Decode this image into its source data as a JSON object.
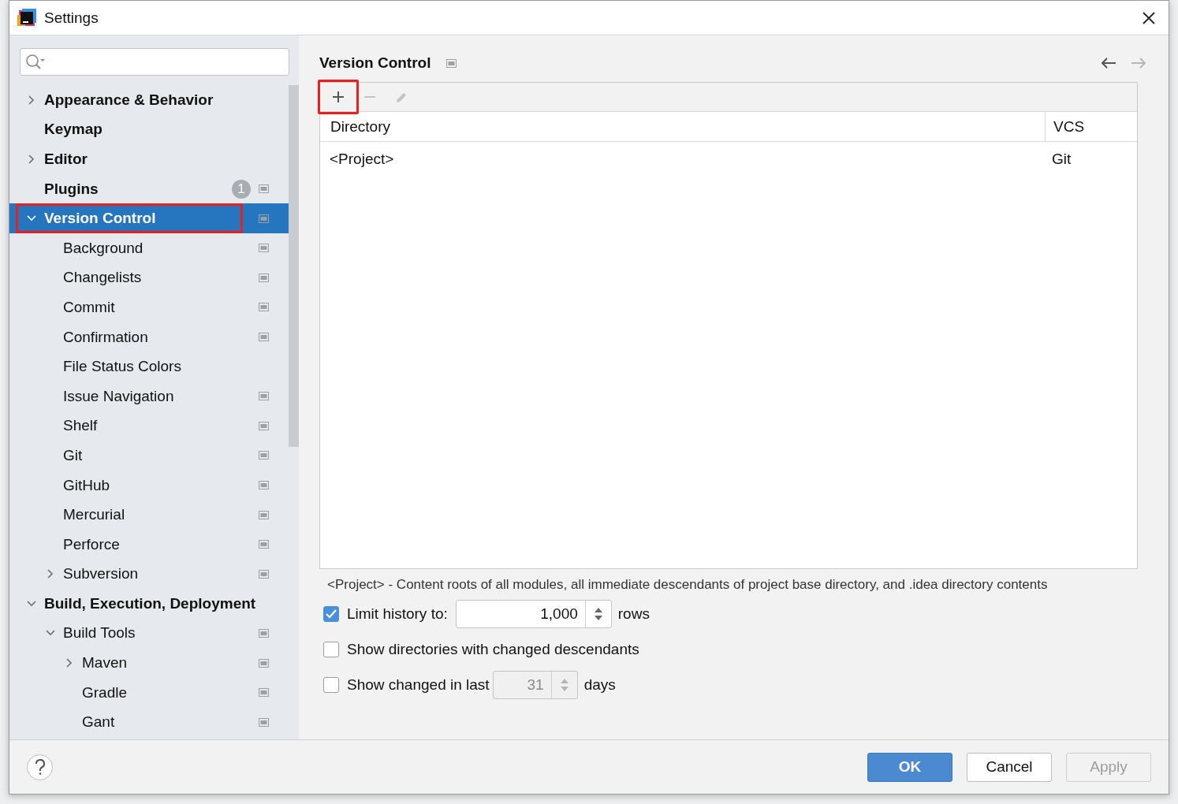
{
  "window": {
    "title": "Settings"
  },
  "tree": [
    {
      "label": "Appearance & Behavior",
      "expanded": false,
      "selected": false
    },
    {
      "label": "Keymap",
      "selected": false
    },
    {
      "label": "Editor",
      "expanded": false,
      "selected": false
    },
    {
      "label": "Plugins",
      "badge": "1",
      "project_scope": true,
      "selected": false
    },
    {
      "label": "Version Control",
      "expanded": true,
      "selected": true,
      "project_scope": true,
      "highlighted": true,
      "children": [
        {
          "label": "Background",
          "project_scope": true,
          "selected": false
        },
        {
          "label": "Changelists",
          "project_scope": true,
          "selected": false
        },
        {
          "label": "Commit",
          "project_scope": true,
          "selected": false
        },
        {
          "label": "Confirmation",
          "project_scope": true,
          "selected": false
        },
        {
          "label": "File Status Colors",
          "selected": false
        },
        {
          "label": "Issue Navigation",
          "project_scope": true,
          "selected": false
        },
        {
          "label": "Shelf",
          "project_scope": true,
          "selected": false
        },
        {
          "label": "Git",
          "project_scope": true,
          "selected": false
        },
        {
          "label": "GitHub",
          "project_scope": true,
          "selected": false
        },
        {
          "label": "Mercurial",
          "project_scope": true,
          "selected": false
        },
        {
          "label": "Perforce",
          "project_scope": true,
          "selected": false
        },
        {
          "label": "Subversion",
          "expanded": false,
          "project_scope": true,
          "selected": false
        }
      ]
    },
    {
      "label": "Build, Execution, Deployment",
      "expanded": true,
      "selected": false,
      "children": [
        {
          "label": "Build Tools",
          "expanded": true,
          "project_scope": true,
          "selected": false,
          "children": [
            {
              "label": "Maven",
              "expanded": false,
              "project_scope": true,
              "selected": false
            },
            {
              "label": "Gradle",
              "project_scope": true,
              "selected": false
            },
            {
              "label": "Gant",
              "project_scope": true,
              "selected": false
            }
          ]
        }
      ]
    }
  ],
  "page": {
    "title": "Version Control",
    "project_scope": true,
    "back_disabled": false,
    "forward_disabled": true
  },
  "toolbar": [
    {
      "kind": "add",
      "disabled": false,
      "highlighted": true
    },
    {
      "kind": "remove",
      "disabled": true,
      "highlighted": false
    },
    {
      "kind": "edit",
      "disabled": true,
      "highlighted": false
    }
  ],
  "table": {
    "columns": [
      "Directory",
      "VCS"
    ],
    "rows": [
      [
        "<Project>",
        "Git"
      ]
    ]
  },
  "note": "<Project> - Content roots of all modules, all immediate descendants of project base directory, and .idea directory contents",
  "options": [
    {
      "kind": "spinner",
      "checked": true,
      "label": "Limit history to:",
      "value": "1,000",
      "suffix": "rows",
      "disabled": false
    },
    {
      "kind": "checkbox",
      "checked": false,
      "label": "Show directories with changed descendants"
    },
    {
      "kind": "spinner",
      "checked": false,
      "label": "Show changed in last",
      "value": "31",
      "suffix": "days",
      "disabled": true
    }
  ],
  "buttons": [
    {
      "label": "OK",
      "kind": "primary",
      "disabled": false
    },
    {
      "label": "Cancel",
      "kind": "normal",
      "disabled": false
    },
    {
      "label": "Apply",
      "kind": "normal",
      "disabled": true
    }
  ]
}
